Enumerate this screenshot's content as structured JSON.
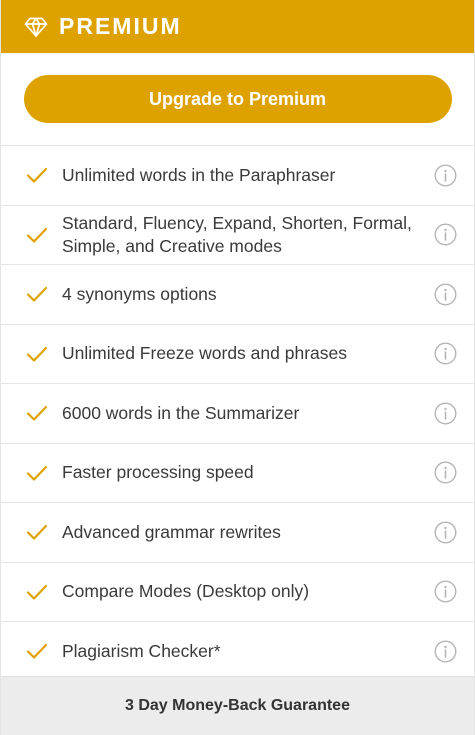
{
  "header": {
    "title": "PREMIUM",
    "icon": "diamond-icon"
  },
  "cta": {
    "label": "Upgrade to Premium"
  },
  "features": [
    {
      "label": "Unlimited words in the Paraphraser"
    },
    {
      "label": "Standard, Fluency, Expand, Shorten, Formal, Simple, and Creative modes"
    },
    {
      "label": "4 synonyms options"
    },
    {
      "label": "Unlimited Freeze words and phrases"
    },
    {
      "label": "6000 words in the Summarizer"
    },
    {
      "label": "Faster processing speed"
    },
    {
      "label": "Advanced grammar rewrites"
    },
    {
      "label": "Compare Modes (Desktop only)"
    },
    {
      "label": "Plagiarism Checker*"
    }
  ],
  "footer": {
    "guarantee": "3 Day Money-Back Guarantee"
  },
  "colors": {
    "accent": "#dea200",
    "check": "#dea200",
    "info": "#b5b5b5",
    "footer_bg": "#ececec"
  }
}
